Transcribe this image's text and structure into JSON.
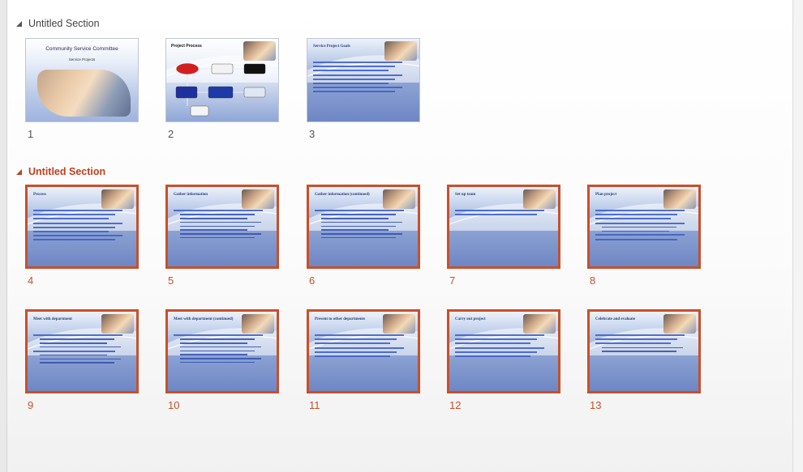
{
  "sections": [
    {
      "title": "Untitled Section",
      "selected": false,
      "slides": [
        {
          "number": "1",
          "kind": "title",
          "line1": "Community Service Committee",
          "line2": "Service Projects"
        },
        {
          "number": "2",
          "kind": "diagram",
          "title": "Project Process"
        },
        {
          "number": "3",
          "kind": "bullets",
          "title": "Service Project Goals",
          "bullets": [
            0,
            0,
            0,
            0,
            0,
            0,
            0,
            0
          ]
        }
      ]
    },
    {
      "title": "Untitled Section",
      "selected": true,
      "slides": [
        {
          "number": "4",
          "kind": "bullets",
          "title": "Process",
          "bullets": [
            0,
            0,
            0,
            0,
            0,
            0,
            0,
            0
          ]
        },
        {
          "number": "5",
          "kind": "bullets",
          "title": "Gather information",
          "bullets": [
            0,
            1,
            1,
            1,
            1,
            1,
            1,
            1
          ]
        },
        {
          "number": "6",
          "kind": "bullets",
          "title": "Gather information (continued)",
          "bullets": [
            0,
            1,
            1,
            1,
            1,
            1,
            1,
            1
          ]
        },
        {
          "number": "7",
          "kind": "bullets",
          "title": "Set up team",
          "bullets": [
            0,
            0
          ]
        },
        {
          "number": "8",
          "kind": "bullets",
          "title": "Plan project",
          "bullets": [
            0,
            0,
            0,
            0,
            1,
            1,
            0,
            0
          ]
        },
        {
          "number": "9",
          "kind": "bullets",
          "title": "Meet with department",
          "bullets": [
            0,
            1,
            1,
            1,
            0,
            1,
            1,
            1
          ]
        },
        {
          "number": "10",
          "kind": "bullets",
          "title": "Meet with department (continued)",
          "bullets": [
            0,
            1,
            1,
            1,
            1,
            1,
            1,
            1
          ]
        },
        {
          "number": "11",
          "kind": "bullets",
          "title": "Present to other departments",
          "bullets": [
            0,
            0,
            0,
            0,
            0,
            0
          ]
        },
        {
          "number": "12",
          "kind": "bullets",
          "title": "Carry out project",
          "bullets": [
            0,
            0,
            0,
            0,
            0,
            0
          ]
        },
        {
          "number": "13",
          "kind": "bullets",
          "title": "Celebrate and evaluate",
          "bullets": [
            0,
            0,
            0,
            1,
            1
          ]
        }
      ]
    }
  ]
}
